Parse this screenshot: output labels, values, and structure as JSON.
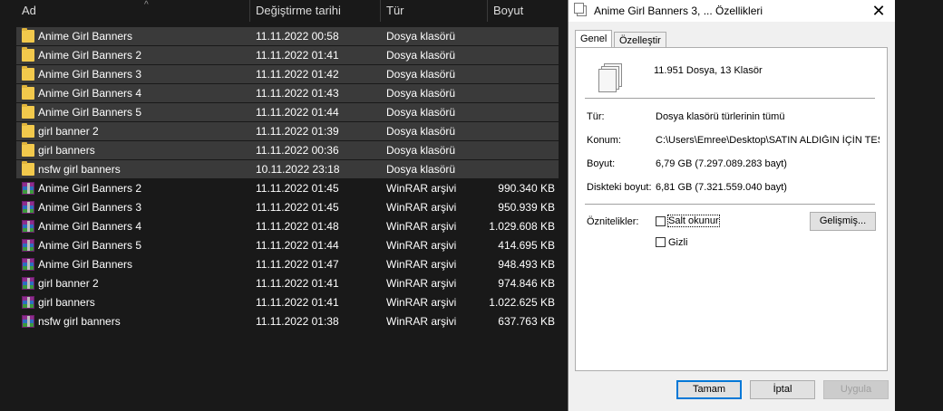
{
  "explorer": {
    "columns": {
      "name": "Ad",
      "date": "Değiştirme tarihi",
      "type": "Tür",
      "size": "Boyut"
    },
    "items": [
      {
        "name": "Anime Girl Banners",
        "date": "11.11.2022 00:58",
        "type": "Dosya klasörü",
        "size": "",
        "kind": "folder",
        "selected": true
      },
      {
        "name": "Anime Girl Banners 2",
        "date": "11.11.2022 01:41",
        "type": "Dosya klasörü",
        "size": "",
        "kind": "folder",
        "selected": true
      },
      {
        "name": "Anime Girl Banners 3",
        "date": "11.11.2022 01:42",
        "type": "Dosya klasörü",
        "size": "",
        "kind": "folder",
        "selected": true
      },
      {
        "name": "Anime Girl Banners 4",
        "date": "11.11.2022 01:43",
        "type": "Dosya klasörü",
        "size": "",
        "kind": "folder",
        "selected": true
      },
      {
        "name": "Anime Girl Banners 5",
        "date": "11.11.2022 01:44",
        "type": "Dosya klasörü",
        "size": "",
        "kind": "folder",
        "selected": true
      },
      {
        "name": "girl banner 2",
        "date": "11.11.2022 01:39",
        "type": "Dosya klasörü",
        "size": "",
        "kind": "folder",
        "selected": true
      },
      {
        "name": "girl banners",
        "date": "11.11.2022 00:36",
        "type": "Dosya klasörü",
        "size": "",
        "kind": "folder",
        "selected": true
      },
      {
        "name": "nsfw girl banners",
        "date": "10.11.2022 23:18",
        "type": "Dosya klasörü",
        "size": "",
        "kind": "folder",
        "selected": true
      },
      {
        "name": "Anime Girl Banners 2",
        "date": "11.11.2022 01:45",
        "type": "WinRAR arşivi",
        "size": "990.340 KB",
        "kind": "rar",
        "selected": false
      },
      {
        "name": "Anime Girl Banners 3",
        "date": "11.11.2022 01:45",
        "type": "WinRAR arşivi",
        "size": "950.939 KB",
        "kind": "rar",
        "selected": false
      },
      {
        "name": "Anime Girl Banners 4",
        "date": "11.11.2022 01:48",
        "type": "WinRAR arşivi",
        "size": "1.029.608 KB",
        "kind": "rar",
        "selected": false
      },
      {
        "name": "Anime Girl Banners 5",
        "date": "11.11.2022 01:44",
        "type": "WinRAR arşivi",
        "size": "414.695 KB",
        "kind": "rar",
        "selected": false
      },
      {
        "name": "Anime Girl Banners",
        "date": "11.11.2022 01:47",
        "type": "WinRAR arşivi",
        "size": "948.493 KB",
        "kind": "rar",
        "selected": false
      },
      {
        "name": "girl banner 2",
        "date": "11.11.2022 01:41",
        "type": "WinRAR arşivi",
        "size": "974.846 KB",
        "kind": "rar",
        "selected": false
      },
      {
        "name": "girl banners",
        "date": "11.11.2022 01:41",
        "type": "WinRAR arşivi",
        "size": "1.022.625 KB",
        "kind": "rar",
        "selected": false
      },
      {
        "name": "nsfw girl banners",
        "date": "11.11.2022 01:38",
        "type": "WinRAR arşivi",
        "size": "637.763 KB",
        "kind": "rar",
        "selected": false
      }
    ]
  },
  "dialog": {
    "title": "Anime Girl Banners 3, ... Özellikleri",
    "tabs": {
      "general": "Genel",
      "customize": "Özelleştir"
    },
    "summary": "11.951 Dosya, 13 Klasör",
    "type_label": "Tür:",
    "type_value": "Dosya klasörü türlerinin tümü",
    "location_label": "Konum:",
    "location_value": "C:\\Users\\Emree\\Desktop\\SATIN ALDIĞIN İÇİN TEŞ",
    "size_label": "Boyut:",
    "size_value": "6,79 GB (7.297.089.283 bayt)",
    "disk_size_label": "Diskteki boyut:",
    "disk_size_value": "6,81 GB (7.321.559.040 bayt)",
    "attributes_label": "Öznitelikler:",
    "readonly_label": "Salt okunur",
    "hidden_label": "Gizli",
    "advanced_button": "Gelişmiş...",
    "ok_button": "Tamam",
    "cancel_button": "İptal",
    "apply_button": "Uygula",
    "close_glyph": "✕"
  }
}
